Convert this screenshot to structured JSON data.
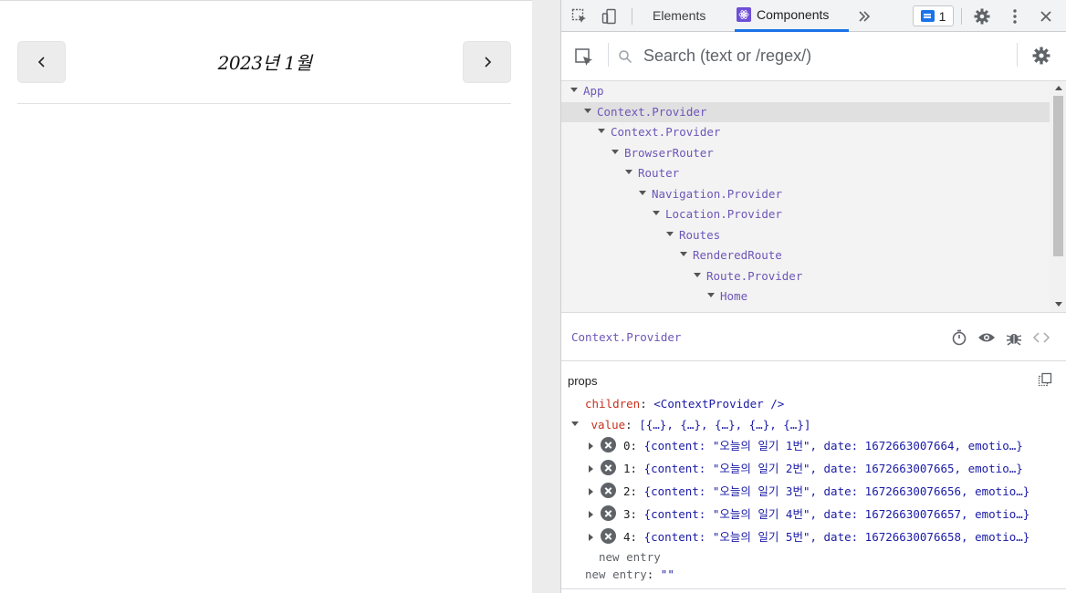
{
  "app": {
    "month_title": "2023년 1월",
    "prev_icon": "chevron-left-icon",
    "next_icon": "chevron-right-icon"
  },
  "devtools": {
    "tabs": {
      "elements": "Elements",
      "components": "Components"
    },
    "message_count": "1",
    "search": {
      "placeholder": "Search (text or /regex/)",
      "value": ""
    },
    "tree": [
      {
        "label": "App",
        "depth": 0
      },
      {
        "label": "Context.Provider",
        "depth": 1,
        "selected": true
      },
      {
        "label": "Context.Provider",
        "depth": 2
      },
      {
        "label": "BrowserRouter",
        "depth": 3
      },
      {
        "label": "Router",
        "depth": 4
      },
      {
        "label": "Navigation.Provider",
        "depth": 5
      },
      {
        "label": "Location.Provider",
        "depth": 6
      },
      {
        "label": "Routes",
        "depth": 7
      },
      {
        "label": "RenderedRoute",
        "depth": 8
      },
      {
        "label": "Route.Provider",
        "depth": 9
      },
      {
        "label": "Home",
        "depth": 10
      }
    ],
    "selected_component": "Context.Provider",
    "props": {
      "title": "props",
      "children_key": "children",
      "children_value": "<ContextProvider />",
      "value_key": "value",
      "value_summary": "[{…}, {…}, {…}, {…}, {…}]",
      "entries": [
        {
          "index": "0",
          "text": "{content: \"오늘의 일기 1번\", date: 1672663007664, emotio…}"
        },
        {
          "index": "1",
          "text": "{content: \"오늘의 일기 2번\", date: 1672663007665, emotio…}"
        },
        {
          "index": "2",
          "text": "{content: \"오늘의 일기 3번\", date: 16726630076656, emotio…}"
        },
        {
          "index": "3",
          "text": "{content: \"오늘의 일기 4번\", date: 16726630076657, emotio…}"
        },
        {
          "index": "4",
          "text": "{content: \"오늘의 일기 5번\", date: 16726630076658, emotio…}"
        }
      ],
      "new_entry_placeholder": "new entry",
      "new_entry_key": "new entry",
      "new_entry_value": "\"\""
    }
  }
}
